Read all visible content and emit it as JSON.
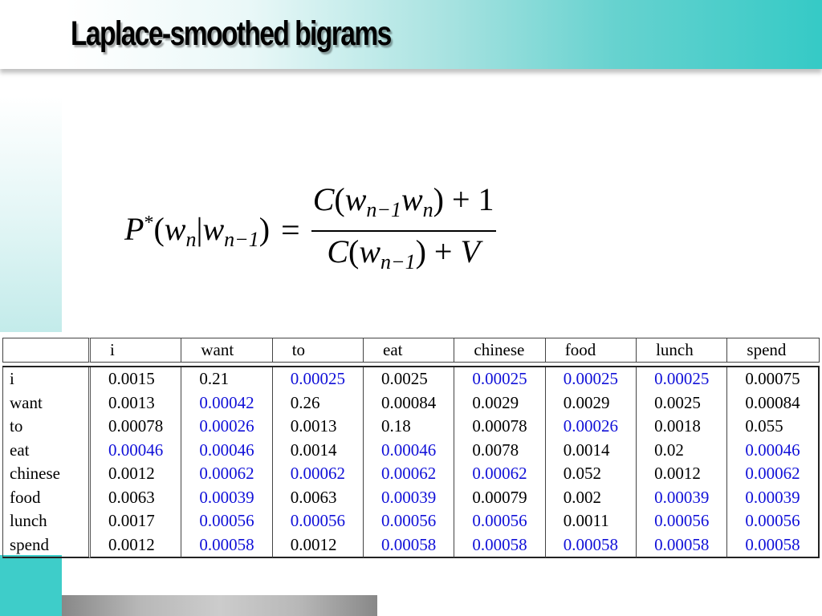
{
  "slide": {
    "title": "Laplace-smoothed bigrams",
    "colors": {
      "accent_teal": "#35cac6",
      "highlight_blue": "#1010d8",
      "text": "#000000"
    }
  },
  "formula": {
    "lhs_P": "P",
    "lhs_star": "*",
    "lhs_open": "(",
    "w": "w",
    "sub_n": "n",
    "bar": "|",
    "sub_n_minus_1": "n−1",
    "lhs_close": ")",
    "equals": "=",
    "numerator_C": "C",
    "numerator_plus_one": "+ 1",
    "denominator_C": "C",
    "denominator_plus_V": "+",
    "V": "V",
    "open": "(",
    "close": ")"
  },
  "table": {
    "columns": [
      "i",
      "want",
      "to",
      "eat",
      "chinese",
      "food",
      "lunch",
      "spend"
    ],
    "rows": [
      {
        "label": "i",
        "cells": [
          {
            "v": "0.0015",
            "blue": false
          },
          {
            "v": "0.21",
            "blue": false
          },
          {
            "v": "0.00025",
            "blue": true
          },
          {
            "v": "0.0025",
            "blue": false
          },
          {
            "v": "0.00025",
            "blue": true
          },
          {
            "v": "0.00025",
            "blue": true
          },
          {
            "v": "0.00025",
            "blue": true
          },
          {
            "v": "0.00075",
            "blue": false
          }
        ]
      },
      {
        "label": "want",
        "cells": [
          {
            "v": "0.0013",
            "blue": false
          },
          {
            "v": "0.00042",
            "blue": true
          },
          {
            "v": "0.26",
            "blue": false
          },
          {
            "v": "0.00084",
            "blue": false
          },
          {
            "v": "0.0029",
            "blue": false
          },
          {
            "v": "0.0029",
            "blue": false
          },
          {
            "v": "0.0025",
            "blue": false
          },
          {
            "v": "0.00084",
            "blue": false
          }
        ]
      },
      {
        "label": "to",
        "cells": [
          {
            "v": "0.00078",
            "blue": false
          },
          {
            "v": "0.00026",
            "blue": true
          },
          {
            "v": "0.0013",
            "blue": false
          },
          {
            "v": "0.18",
            "blue": false
          },
          {
            "v": "0.00078",
            "blue": false
          },
          {
            "v": "0.00026",
            "blue": true
          },
          {
            "v": "0.0018",
            "blue": false
          },
          {
            "v": "0.055",
            "blue": false
          }
        ]
      },
      {
        "label": "eat",
        "cells": [
          {
            "v": "0.00046",
            "blue": true
          },
          {
            "v": "0.00046",
            "blue": true
          },
          {
            "v": "0.0014",
            "blue": false
          },
          {
            "v": "0.00046",
            "blue": true
          },
          {
            "v": "0.0078",
            "blue": false
          },
          {
            "v": "0.0014",
            "blue": false
          },
          {
            "v": "0.02",
            "blue": false
          },
          {
            "v": "0.00046",
            "blue": true
          }
        ]
      },
      {
        "label": "chinese",
        "cells": [
          {
            "v": "0.0012",
            "blue": false
          },
          {
            "v": "0.00062",
            "blue": true
          },
          {
            "v": "0.00062",
            "blue": true
          },
          {
            "v": "0.00062",
            "blue": true
          },
          {
            "v": "0.00062",
            "blue": true
          },
          {
            "v": "0.052",
            "blue": false
          },
          {
            "v": "0.0012",
            "blue": false
          },
          {
            "v": "0.00062",
            "blue": true
          }
        ]
      },
      {
        "label": "food",
        "cells": [
          {
            "v": "0.0063",
            "blue": false
          },
          {
            "v": "0.00039",
            "blue": true
          },
          {
            "v": "0.0063",
            "blue": false
          },
          {
            "v": "0.00039",
            "blue": true
          },
          {
            "v": "0.00079",
            "blue": false
          },
          {
            "v": "0.002",
            "blue": false
          },
          {
            "v": "0.00039",
            "blue": true
          },
          {
            "v": "0.00039",
            "blue": true
          }
        ]
      },
      {
        "label": "lunch",
        "cells": [
          {
            "v": "0.0017",
            "blue": false
          },
          {
            "v": "0.00056",
            "blue": true
          },
          {
            "v": "0.00056",
            "blue": true
          },
          {
            "v": "0.00056",
            "blue": true
          },
          {
            "v": "0.00056",
            "blue": true
          },
          {
            "v": "0.0011",
            "blue": false
          },
          {
            "v": "0.00056",
            "blue": true
          },
          {
            "v": "0.00056",
            "blue": true
          }
        ]
      },
      {
        "label": "spend",
        "cells": [
          {
            "v": "0.0012",
            "blue": false
          },
          {
            "v": "0.00058",
            "blue": true
          },
          {
            "v": "0.0012",
            "blue": false
          },
          {
            "v": "0.00058",
            "blue": true
          },
          {
            "v": "0.00058",
            "blue": true
          },
          {
            "v": "0.00058",
            "blue": true
          },
          {
            "v": "0.00058",
            "blue": true
          },
          {
            "v": "0.00058",
            "blue": true
          }
        ]
      }
    ]
  }
}
